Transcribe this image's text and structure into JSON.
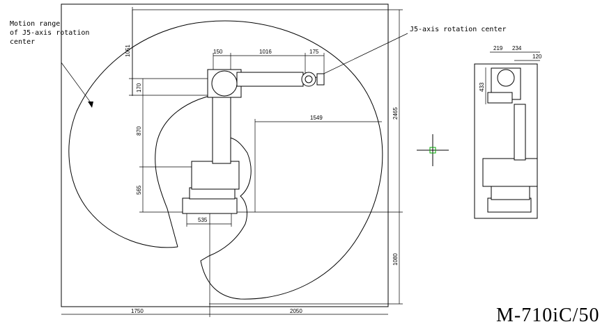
{
  "annotations": {
    "motion_range": [
      "Motion range",
      "of J5-axis rotation",
      "center"
    ],
    "j5_center": "J5-axis rotation center"
  },
  "dimensions": {
    "top_1051": "1051",
    "top_150": "150",
    "top_1016": "1016",
    "top_175": "175",
    "left_170": "170",
    "left_870": "870",
    "left_565": "565",
    "right_2465": "2465",
    "right_1080": "1080",
    "reach_1549": "1549",
    "base_535": "535",
    "bottom_1750": "1750",
    "bottom_2050": "2050",
    "side_219": "219",
    "side_234": "234",
    "side_120": "120",
    "side_433": "433"
  },
  "model_name": "M-710iC/50",
  "colors": {
    "line": "#000000",
    "crosshair": "#00aa00",
    "background": "#ffffff"
  }
}
